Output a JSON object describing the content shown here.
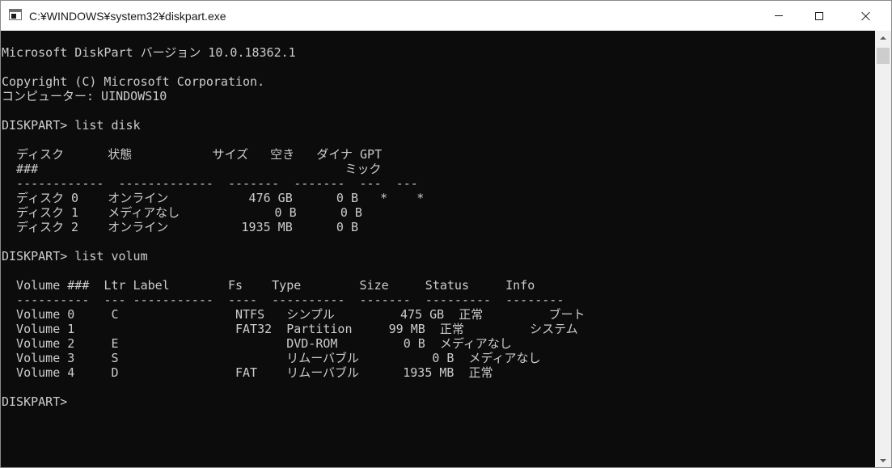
{
  "window": {
    "title": "C:¥WINDOWS¥system32¥diskpart.exe",
    "icon": "console-app-icon",
    "controls": {
      "minimize": "minimize-icon",
      "maximize": "maximize-icon",
      "close": "close-icon"
    }
  },
  "colors": {
    "console_bg": "#0c0c0c",
    "console_fg": "#cccccc",
    "titlebar_bg": "#ffffff",
    "scrollbar_bg": "#f0f0f0"
  },
  "console": {
    "lines": [
      "Microsoft DiskPart バージョン 10.0.18362.1",
      "",
      "Copyright (C) Microsoft Corporation.",
      "コンピューター: UINDOWS10",
      "",
      "DISKPART> list disk",
      "",
      "  ディスク      状態           サイズ   空き   ダイナ GPT",
      "  ###                                          ミック",
      "  ------------  -------------  -------  -------  ---  ---",
      "  ディスク 0    オンライン           476 GB      0 B   *    *",
      "  ディスク 1    メディアなし             0 B      0 B",
      "  ディスク 2    オンライン          1935 MB      0 B",
      "",
      "DISKPART> list volum",
      "",
      "  Volume ###  Ltr Label        Fs    Type        Size     Status     Info",
      "  ----------  --- -----------  ----  ----------  -------  ---------  --------",
      "  Volume 0     C                NTFS   シンプル         475 GB  正常         ブート",
      "  Volume 1                      FAT32  Partition     99 MB  正常         システム",
      "  Volume 2     E                       DVD-ROM         0 B  メディアなし",
      "  Volume 3     S                       リムーバブル          0 B  メディアなし",
      "  Volume 4     D                FAT    リムーバブル      1935 MB  正常",
      "",
      "DISKPART>"
    ]
  }
}
